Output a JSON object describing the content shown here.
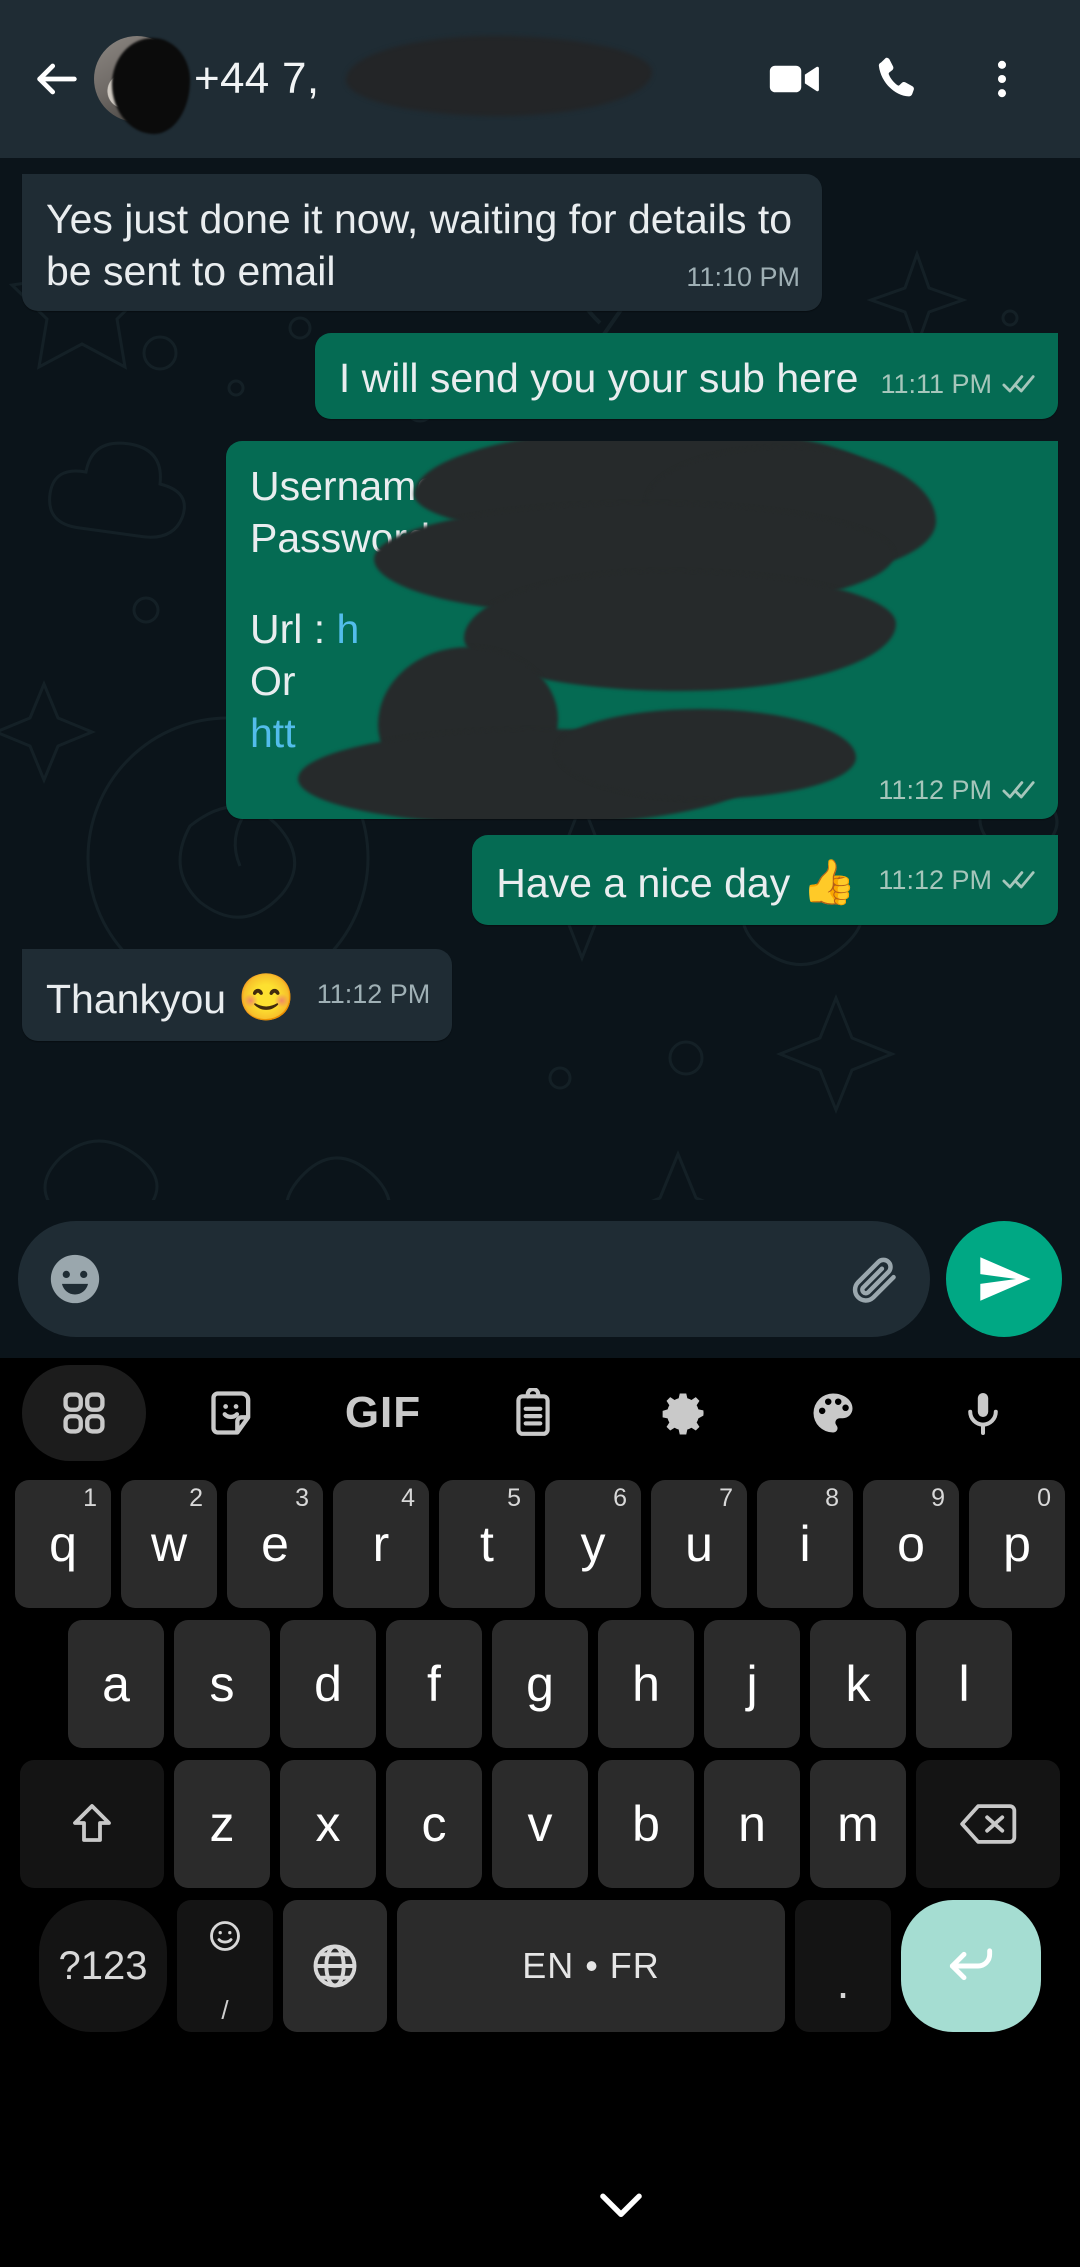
{
  "header": {
    "back_icon": "back-arrow-icon",
    "avatar_label": "contact-avatar",
    "title": "+44 7,",
    "video_call_label": "video-call-icon",
    "voice_call_label": "voice-call-icon",
    "overflow_label": "more-options-icon"
  },
  "messages": [
    {
      "direction": "in",
      "text": "Yes just done it now, waiting for details to be sent to email",
      "time": "11:10 PM",
      "status": "none"
    },
    {
      "direction": "out",
      "text": "I will send you your sub here",
      "time": "11:11 PM",
      "status": "read"
    },
    {
      "direction": "out",
      "type": "credentials",
      "lines": [
        {
          "label": "Username: ",
          "value": "",
          "redacted": true
        },
        {
          "label": "Password: ",
          "value": "",
          "redacted": true
        },
        {
          "label": "",
          "value": "",
          "redacted": false
        },
        {
          "label": "Url : ",
          "value": "h",
          "link": true,
          "redacted": true
        },
        {
          "label": "Or",
          "value": "",
          "redacted": false
        },
        {
          "label": "",
          "value": "htt",
          "link": true,
          "redacted": true
        }
      ],
      "time": "11:12 PM",
      "status": "read"
    },
    {
      "direction": "out",
      "text": "Have a nice day ",
      "emoji": "👍",
      "time": "11:12 PM",
      "status": "read"
    },
    {
      "direction": "in",
      "text": "Thankyou ",
      "emoji": "😊",
      "time": "11:12 PM",
      "status": "none"
    }
  ],
  "scroll_button": {
    "icon": "double-chevron-down-icon"
  },
  "composer": {
    "emoji_icon": "emoji-smiley-icon",
    "placeholder": "",
    "value": "",
    "attach_icon": "paperclip-icon",
    "send_icon": "send-icon"
  },
  "keyboard": {
    "toolbar": [
      {
        "name": "apps-grid-icon",
        "label": ""
      },
      {
        "name": "sticker-icon",
        "label": ""
      },
      {
        "name": "gif-icon",
        "label": "GIF"
      },
      {
        "name": "clipboard-icon",
        "label": ""
      },
      {
        "name": "settings-gear-icon",
        "label": ""
      },
      {
        "name": "theme-palette-icon",
        "label": ""
      },
      {
        "name": "microphone-icon",
        "label": ""
      }
    ],
    "row1": [
      {
        "key": "q",
        "num": "1"
      },
      {
        "key": "w",
        "num": "2"
      },
      {
        "key": "e",
        "num": "3"
      },
      {
        "key": "r",
        "num": "4"
      },
      {
        "key": "t",
        "num": "5"
      },
      {
        "key": "y",
        "num": "6"
      },
      {
        "key": "u",
        "num": "7"
      },
      {
        "key": "i",
        "num": "8"
      },
      {
        "key": "o",
        "num": "9"
      },
      {
        "key": "p",
        "num": "0"
      }
    ],
    "row2": [
      {
        "key": "a"
      },
      {
        "key": "s"
      },
      {
        "key": "d"
      },
      {
        "key": "f"
      },
      {
        "key": "g"
      },
      {
        "key": "h"
      },
      {
        "key": "j"
      },
      {
        "key": "k"
      },
      {
        "key": "l"
      }
    ],
    "row3": [
      {
        "key": "z"
      },
      {
        "key": "x"
      },
      {
        "key": "c"
      },
      {
        "key": "v"
      },
      {
        "key": "b"
      },
      {
        "key": "n"
      },
      {
        "key": "m"
      }
    ],
    "shift_icon": "shift-up-arrow-icon",
    "backspace_icon": "backspace-delete-icon",
    "symbols_label": "?123",
    "emoji_key_sub": "/",
    "language_icon": "globe-language-icon",
    "space_label": "EN • FR",
    "period_label": ".",
    "enter_icon": "enter-return-icon"
  },
  "navbar": {
    "hide_keyboard_icon": "chevron-down-icon"
  },
  "colors": {
    "header_bg": "#1f2c34",
    "chat_bg": "#0b141a",
    "bubble_in": "#1f2c34",
    "bubble_out": "#056b53",
    "accent_send": "#00a884",
    "link": "#53bdeb",
    "tick_read": "#a6c6bb",
    "enter_key": "#a5ddd2",
    "key_bg": "#2b2b2b",
    "keyboard_bg": "#000000"
  }
}
